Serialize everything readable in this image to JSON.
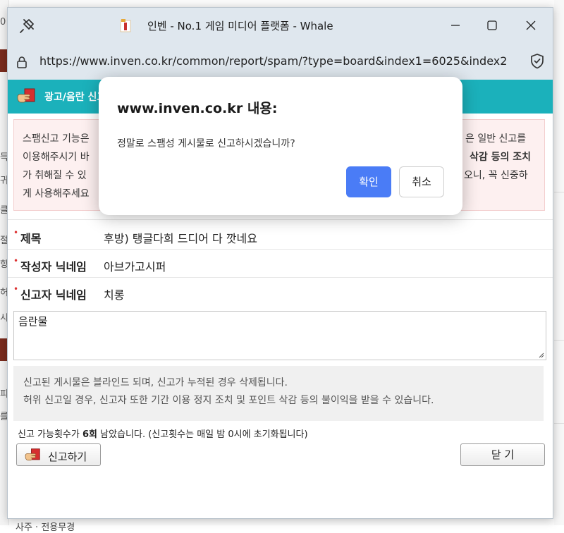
{
  "window": {
    "title": "인벤 - No.1 게임 미디어 플랫폼 - Whale",
    "url": "https://www.inven.co.kr/common/report/spam/?type=board&index1=6025&index2"
  },
  "background": {
    "left_chars": [
      "0",
      "에",
      "지",
      "나",
      "득",
      "귀",
      "클",
      "절",
      "의",
      "항",
      "허",
      "시",
      "파",
      "피",
      "를"
    ],
    "bottom_text": "사주 · 전용무경"
  },
  "report": {
    "header_title": "광고/음란 신고",
    "notice_lines": [
      "스팸신고 기능은",
      "은 일반 신고를",
      "이용해주시기 바",
      "삭감 등의 조치",
      "가 취해질 수 있",
      "오니, 꼭 신중하",
      "게 사용해주세요"
    ],
    "fields": {
      "subject_label": "제목",
      "subject_value": "후방) 탱글다희 드디어 다 깟네요",
      "author_label": "작성자 닉네임",
      "author_value": "아브가고시퍼",
      "reporter_label": "신고자 닉네임",
      "reporter_value": "치롱"
    },
    "reason_text": "음란물",
    "info_line1": "신고된 게시물은 블라인드 되며, 신고가 누적된 경우 삭제됩니다.",
    "info_line2": "허위 신고일 경우, 신고자 또한 기간 이용 정지 조치 및 포인트 삭감 등의 불이익을 받을 수 있습니다.",
    "remaining_prefix": "신고 가능횟수가 ",
    "remaining_count": "6회",
    "remaining_suffix": " 남았습니다. (신고횟수는 매일 밤 0시에 초기화됩니다)",
    "report_button": "신고하기",
    "close_button": "닫 기"
  },
  "dialog": {
    "title": "www.inven.co.kr 내용:",
    "message": "정말로 스팸성 게시물로 신고하시겠습니까?",
    "ok_label": "확인",
    "cancel_label": "취소"
  },
  "colors": {
    "header_teal": "#1bb1bb",
    "notice_bg": "#fdf0f0",
    "ok_blue": "#4a7cf6",
    "titlebar": "#dfe7ee"
  }
}
